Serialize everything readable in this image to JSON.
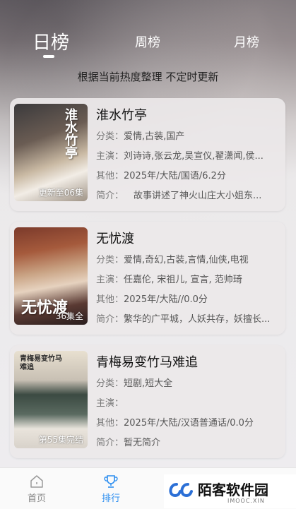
{
  "tabs": [
    {
      "label": "日榜",
      "active": true
    },
    {
      "label": "周榜",
      "active": false
    },
    {
      "label": "月榜",
      "active": false
    }
  ],
  "subtitle": "根据当前热度整理 不定时更新",
  "labels": {
    "genre": "分类：",
    "cast": "主演：",
    "other": "其他：",
    "intro": "简介："
  },
  "items": [
    {
      "title": "淮水竹亭",
      "poster_art": "淮水竹亭",
      "badge": "更新至06集",
      "genre": "爱情,古装,国产",
      "cast": "刘诗诗,张云龙,吴宣仪,翟潇闻,侯...",
      "other": "2025年/大陆/国语/6.2分",
      "intro": "故事讲述了神火山庄大小姐东..."
    },
    {
      "title": "无忧渡",
      "poster_art": "无忧渡",
      "badge": "36集全",
      "genre": "爱情,奇幻,古装,言情,仙侠,电视",
      "cast": "任嘉伦, 宋祖儿, 宣言, 范帅琦",
      "other": "2025年/大陆//0.0分",
      "intro": "繁华的广平城，人妖共存，妖擅长..."
    },
    {
      "title": "青梅易变竹马难追",
      "poster_art": "青梅易变竹马难追",
      "badge": "第55集完结",
      "genre": "短剧,短大全",
      "cast": "",
      "other": "2025年/大陆/汉语普通话/0.0分",
      "intro": "暂无简介"
    }
  ],
  "bottom_nav": [
    {
      "label": "首页",
      "icon": "home-icon",
      "active": false
    },
    {
      "label": "排行",
      "icon": "trophy-icon",
      "active": true
    }
  ],
  "watermark": {
    "text": "陌客软件园",
    "sub": "IMOOC.XIN"
  },
  "colors": {
    "accent": "#2c8ef0"
  }
}
